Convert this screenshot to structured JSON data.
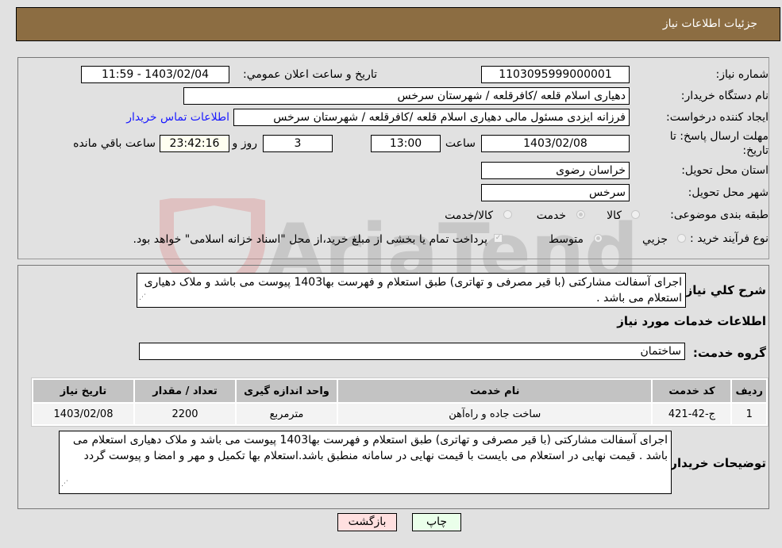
{
  "header": {
    "title": "جزئیات اطلاعات نیاز"
  },
  "form": {
    "need_number": {
      "label": "شماره نیاز:",
      "value": "1103095999000001"
    },
    "announce_datetime": {
      "label": "تاریخ و ساعت اعلان عمومي:",
      "value": "1403/02/04 - 11:59"
    },
    "buyer_org": {
      "label": "نام دستگاه خریدار:",
      "value": "دهیاری اسلام قلعه /کافرقلعه / شهرستان سرخس"
    },
    "requester": {
      "label": "ایجاد کننده درخواست:",
      "value": "فرزانه ایزدی مسئول مالی دهیاری اسلام قلعه /کافرقلعه / شهرستان سرخس",
      "contact_link": "اطلاعات تماس خریدار"
    },
    "deadline": {
      "label_line1": "مهلت ارسال پاسخ: تا",
      "label_line2": "تاریخ:",
      "date": "1403/02/08",
      "time_label": "ساعت",
      "time": "13:00",
      "days": "3",
      "days_label": "روز و",
      "remaining": "23:42:16",
      "remaining_label": "ساعت باقي مانده"
    },
    "province": {
      "label": "استان محل تحویل:",
      "value": "خراسان رضوی"
    },
    "city": {
      "label": "شهر محل تحویل:",
      "value": "سرخس"
    },
    "category": {
      "label": "طبقه بندی موضوعی:",
      "options": [
        "کالا",
        "خدمت",
        "کالا/خدمت"
      ],
      "selected": "خدمت"
    },
    "purchase_type": {
      "label": "نوع فرآیند خرید :",
      "options": [
        "جزيي",
        "متوسط"
      ],
      "selected": "متوسط",
      "treasury_note": "پرداخت تمام یا بخشی از مبلغ خرید،از محل \"اسناد خزانه اسلامی\" خواهد بود."
    }
  },
  "description": {
    "label": "شرح کلي نیاز:",
    "value": "اجرای آسفالت مشارکتی (با قیر مصرفی و تهاتری) طبق استعلام و فهرست بها1403 پیوست می باشد و ملاک دهیاری استعلام می باشد ."
  },
  "services_section": {
    "title": "اطلاعات خدمات مورد نیاز",
    "group_label": "گروه خدمت:",
    "group_value": "ساختمان"
  },
  "table": {
    "headers": [
      "ردیف",
      "کد خدمت",
      "نام خدمت",
      "واحد اندازه گیری",
      "تعداد / مقدار",
      "تاریخ نیاز"
    ],
    "rows": [
      [
        "1",
        "ج-42-421",
        "ساخت جاده و راه‌آهن",
        "مترمربع",
        "2200",
        "1403/02/08"
      ]
    ]
  },
  "buyer_notes": {
    "label": "توضیحات خریدار:",
    "value": "اجرای آسفالت مشارکتی (با قیر مصرفی و تهاتری) طبق استعلام و فهرست بها1403 پیوست می باشد و ملاک دهیاری استعلام می باشد . قیمت نهایی در استعلام می بایست با قیمت نهایی در سامانه منطبق باشد.استعلام بها تکمیل و مهر و امضا و پیوست گردد"
  },
  "buttons": {
    "print": "چاپ",
    "back": "بازگشت"
  },
  "watermark": {
    "text": "AriaTender.neT"
  },
  "colors": {
    "header_bg": "#8c6d42",
    "print_bg": "#eaffea",
    "back_bg": "#ffe0e0",
    "link": "#1a1aff"
  }
}
